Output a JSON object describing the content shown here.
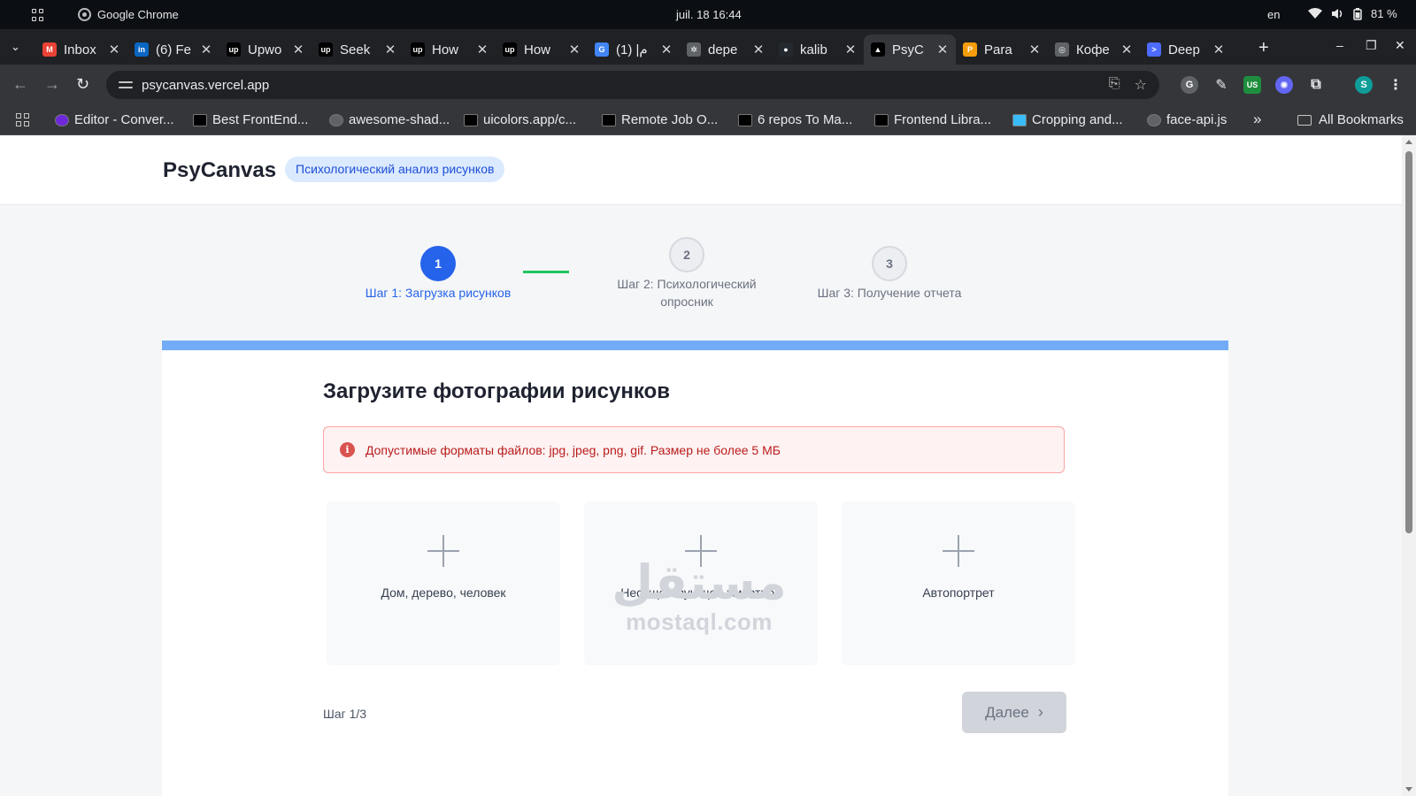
{
  "os": {
    "app_name": "Google Chrome",
    "clock": "juil. 18  16:44",
    "lang": "en",
    "battery": "81 %"
  },
  "browser": {
    "tabs": [
      {
        "title": "Inbox",
        "favicon": "gmail-icon",
        "color": "#ea4335",
        "letter": "M"
      },
      {
        "title": "(6) Fe",
        "favicon": "linkedin-icon",
        "color": "#0a66c2",
        "letter": "in"
      },
      {
        "title": "Upwo",
        "favicon": "upwork-icon",
        "color": "#000000",
        "letter": "up"
      },
      {
        "title": "Seek",
        "favicon": "upwork-icon",
        "color": "#000000",
        "letter": "up"
      },
      {
        "title": "How",
        "favicon": "upwork-icon",
        "color": "#000000",
        "letter": "up"
      },
      {
        "title": "How",
        "favicon": "upwork-icon",
        "color": "#000000",
        "letter": "up"
      },
      {
        "title": "م| (1)",
        "favicon": "google-icon",
        "color": "#4285f4",
        "letter": "G"
      },
      {
        "title": "depe",
        "favicon": "gear-icon",
        "color": "#5f6368",
        "letter": "✲"
      },
      {
        "title": "kalib",
        "favicon": "github-icon",
        "color": "#24292f",
        "letter": "●"
      },
      {
        "title": "PsyC",
        "favicon": "vercel-icon",
        "color": "#000000",
        "letter": "▲"
      },
      {
        "title": "Para",
        "favicon": "para-icon",
        "color": "#f59e0b",
        "letter": "P"
      },
      {
        "title": "Кофе",
        "favicon": "globe-icon",
        "color": "#5f6368",
        "letter": "◎"
      },
      {
        "title": "Deep",
        "favicon": "deepseek-icon",
        "color": "#4d6bfe",
        "letter": ">"
      }
    ],
    "active_tab": 9,
    "url": "psycanvas.vercel.app",
    "profile_letter": "S",
    "ext_badge": "US",
    "bookmarks": [
      {
        "label": "Editor - Conver...",
        "icon": "editor-icon"
      },
      {
        "label": "Best FrontEnd...",
        "icon": "dev-icon"
      },
      {
        "label": "awesome-shad...",
        "icon": "globe-icon"
      },
      {
        "label": "uicolors.app/c...",
        "icon": "ui-icon"
      },
      {
        "label": "Remote Job O...",
        "icon": "job-icon"
      },
      {
        "label": "6 repos To Ma...",
        "icon": "medium-icon"
      },
      {
        "label": "Frontend Libra...",
        "icon": "dev-icon"
      },
      {
        "label": "Cropping and...",
        "icon": "tailwind-icon"
      },
      {
        "label": "face-api.js",
        "icon": "globe-icon"
      }
    ],
    "more_bookmarks": "»",
    "all_bookmarks": "All Bookmarks"
  },
  "site": {
    "brand": "PsyCanvas",
    "badge": "Психологический анализ рисунков"
  },
  "stepper": {
    "steps": [
      {
        "number": "1",
        "label": "Шаг 1: Загрузка рисунков",
        "state": "active"
      },
      {
        "number": "2",
        "label_line1": "Шаг 2: Психологический",
        "label_line2": "опросник",
        "state": "idle"
      },
      {
        "number": "3",
        "label": "Шаг 3: Получение отчета",
        "state": "idle"
      }
    ]
  },
  "upload_card": {
    "title": "Загрузите фотографии рисунков",
    "alert": "Допустимые форматы файлов: jpg, jpeg, png, gif. Размер не более 5 МБ",
    "slots": [
      {
        "label": "Дом, дерево, человек"
      },
      {
        "label": "Несуществующее животное"
      },
      {
        "label": "Автопортрет"
      }
    ],
    "step_counter": "Шаг 1/3",
    "next_button": "Далее"
  },
  "watermark": {
    "arabic": "مستقل",
    "latin": "mostaql.com"
  },
  "colors": {
    "accent": "#2563eb",
    "progress": "#72acf6",
    "step_connector": "#22c55e",
    "alert_text": "#b91c1c"
  }
}
